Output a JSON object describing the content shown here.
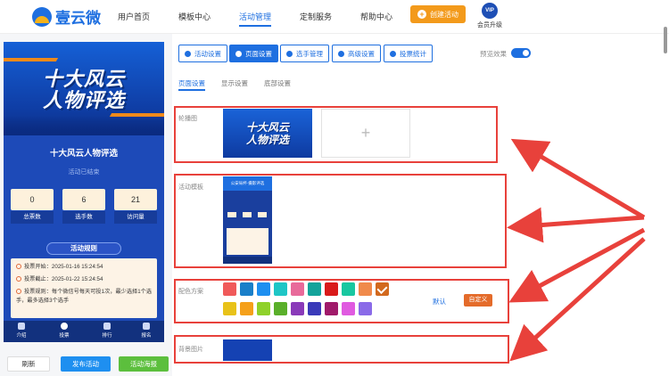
{
  "header": {
    "logo_text": "壹云微",
    "nav": [
      {
        "label": "用户首页",
        "active": false
      },
      {
        "label": "模板中心",
        "active": false
      },
      {
        "label": "活动管理",
        "active": true
      },
      {
        "label": "定制服务",
        "active": false
      },
      {
        "label": "帮助中心",
        "active": false
      }
    ],
    "create_label": "创建活动",
    "vip_badge": "VIP",
    "vip_label": "会员升级"
  },
  "preview": {
    "banner_line1": "十大风云",
    "banner_line2": "人物评选",
    "title": "十大风云人物评选",
    "status": "活动已结束",
    "stats": [
      {
        "value": "0",
        "label": "总票数"
      },
      {
        "value": "6",
        "label": "选手数"
      },
      {
        "value": "21",
        "label": "访问量"
      }
    ],
    "rules_title": "活动规则",
    "rules": [
      "投票开始：2025-01-16 15:24:54",
      "投票截止：2025-01-22 15:24:54",
      "投票规则：每个微信号每天可投1次，最少选择1个选手，最多选择3个选手"
    ],
    "bottom_nav": [
      {
        "label": "介绍",
        "active": false
      },
      {
        "label": "投票",
        "active": true
      },
      {
        "label": "排行",
        "active": false
      },
      {
        "label": "报名",
        "active": false
      }
    ]
  },
  "actions": {
    "refresh": "刷新",
    "publish": "发布活动",
    "poster": "活动海报"
  },
  "settings": {
    "tabs": [
      {
        "label": "活动设置",
        "active": false
      },
      {
        "label": "页面设置",
        "active": true
      },
      {
        "label": "选手管理",
        "active": false
      },
      {
        "label": "高级设置",
        "active": false
      },
      {
        "label": "投票统计",
        "active": false
      }
    ],
    "preview_label": "预览效果",
    "preview_on": true,
    "subtabs": [
      {
        "label": "页面设置",
        "active": true
      },
      {
        "label": "显示设置",
        "active": false
      },
      {
        "label": "底部设置",
        "active": false
      }
    ],
    "carousel_label": "轮播图",
    "carousel_img_line1": "十大风云",
    "carousel_img_line2": "人物评选",
    "add_symbol": "+",
    "template_label": "活动模板",
    "template_head": "公安局杯·摄影评选",
    "color_label": "配色方案",
    "colors_row1": [
      "#f05a5a",
      "#1a7fc9",
      "#1e8ff0",
      "#1ec6c6",
      "#e86a9a",
      "#13a39a",
      "#d91a1a",
      "#19c7a0",
      "#f08a4b",
      "#d2691e"
    ],
    "colors_row2": [
      "#e8c21a",
      "#f5a01a",
      "#8fd12a",
      "#5aaf2a",
      "#8a3ab9",
      "#3a3ab9",
      "#a01a6a",
      "#e05ae0",
      "#8a6ae8"
    ],
    "selected_color": 9,
    "default_label": "默认",
    "custom_label": "自定义",
    "bg_label": "背景图片"
  }
}
